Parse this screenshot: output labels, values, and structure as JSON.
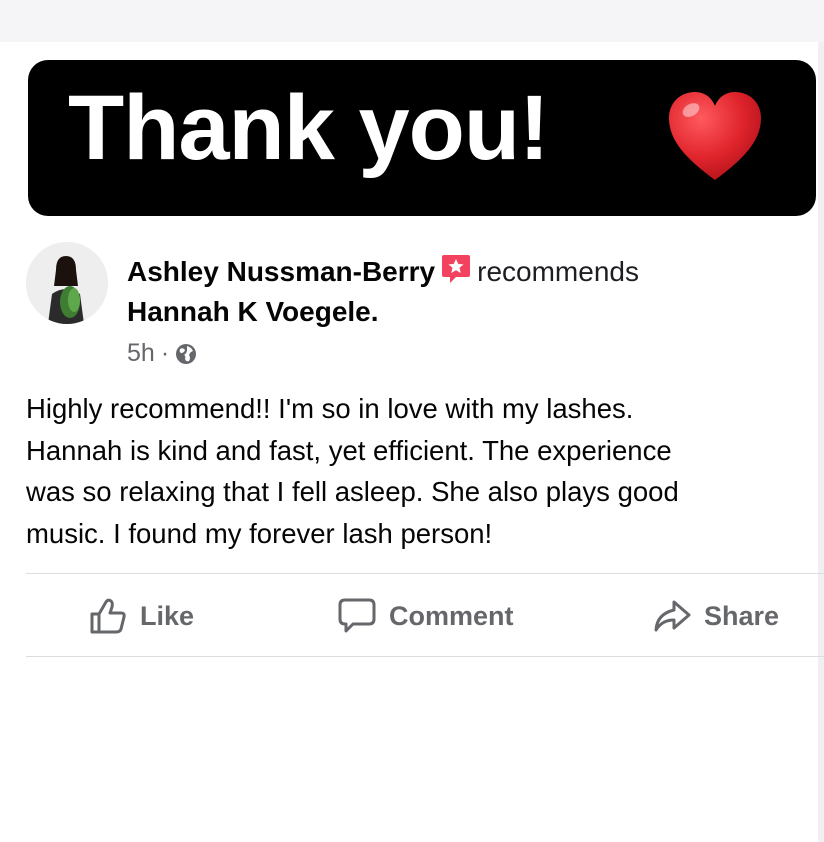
{
  "banner": {
    "text": "Thank you!",
    "emoji": "heart"
  },
  "post": {
    "author": "Ashley Nussman-Berry",
    "action_word": "recommends",
    "page": "Hannah K Voegele.",
    "time": "5h",
    "separator": "·",
    "body_lines": [
      "Highly recommend!! I'm so in love with my lashes.",
      "Hannah is kind and fast, yet efficient. The experience",
      "was so relaxing that I fell asleep. She also plays good",
      "music. I found my forever lash person!"
    ]
  },
  "actions": {
    "like": "Like",
    "comment": "Comment",
    "share": "Share"
  },
  "icons": [
    "heart-emoji-icon",
    "recommendation-badge-icon",
    "globe-icon",
    "like-thumb-icon",
    "comment-bubble-icon",
    "share-arrow-icon"
  ],
  "colors": {
    "banner_bg": "#000000",
    "heart": "#e0242c",
    "badge": "#f3425f",
    "muted": "#65676b"
  }
}
